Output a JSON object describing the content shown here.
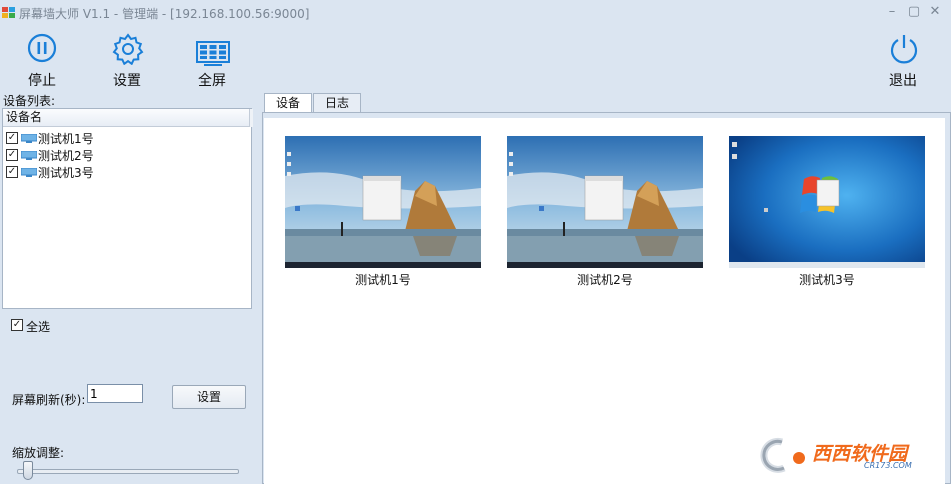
{
  "window": {
    "title": "屏幕墙大师 V1.1 - 管理端 - [192.168.100.56:9000]",
    "controls": [
      "minimize-icon",
      "maximize-icon",
      "close-icon"
    ]
  },
  "toolbar": {
    "stop_label": "停止",
    "settings_label": "设置",
    "fullscreen_label": "全屏",
    "exit_label": "退出",
    "icon_color": "#1a7fd8"
  },
  "left": {
    "list_title": "设备列表:",
    "column_header": "设备名",
    "devices": [
      {
        "name": "测试机1号",
        "checked": true
      },
      {
        "name": "测试机2号",
        "checked": true
      },
      {
        "name": "测试机3号",
        "checked": true
      }
    ],
    "select_all_label": "全选",
    "select_all_checked": true,
    "refresh_label": "屏幕刷新(秒):",
    "refresh_value": "1",
    "set_button": "设置",
    "zoom_label": "缩放调整:",
    "zoom_level": 0
  },
  "tabs": [
    {
      "label": "设备",
      "active": true
    },
    {
      "label": "日志",
      "active": false
    }
  ],
  "screens": [
    {
      "label": "测试机1号",
      "wallpaper": "win10-beach"
    },
    {
      "label": "测试机2号",
      "wallpaper": "win10-beach"
    },
    {
      "label": "测试机3号",
      "wallpaper": "win7-blue"
    }
  ],
  "watermark": {
    "text": "西西软件园",
    "url": "CR173.COM"
  }
}
